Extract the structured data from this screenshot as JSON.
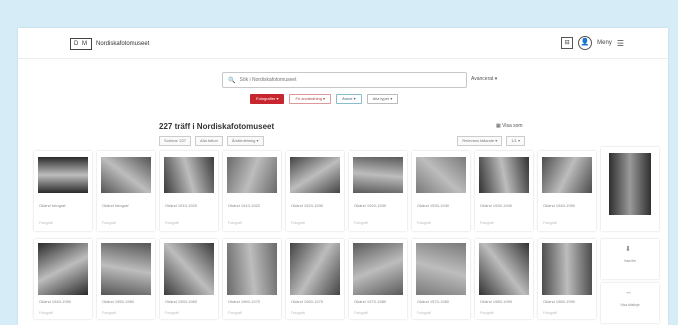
{
  "header": {
    "logo_box": "D M",
    "logo_text": "Nordiskafoto­museet",
    "icon_square": "⊟",
    "icon_avatar": "👤",
    "menu_label": "Meny",
    "hamburger": "☰"
  },
  "search": {
    "placeholder": "Sök i Nordiskafotomuseet",
    "advanced": "Avancerat ▾"
  },
  "filters": [
    "Fotografier ▾",
    "Fri användning ▾",
    "Ämne ▾",
    "Alla typer ▾"
  ],
  "results": {
    "title": "227 träff i Nordiskafotomuseet",
    "view_toggle": "▦ Visa som",
    "sort_left": [
      "Sortera: 227",
      "Alla fotton",
      "Årsfördelning ▾"
    ],
    "sort_right": [
      "Relevans fallande ▾",
      "1/1 ▾"
    ]
  },
  "cards": [
    {
      "l1": "Okänd fotograf",
      "l2": "Fotografi"
    },
    {
      "l1": "Okänd fotograf",
      "l2": "Fotografi"
    },
    {
      "l1": "Okänd 1910-1920",
      "l2": "Fotografi"
    },
    {
      "l1": "Okänd 1910-1920",
      "l2": "Fotografi"
    },
    {
      "l1": "Okänd 1920-1930",
      "l2": "Fotografi"
    },
    {
      "l1": "Okänd 1920-1930",
      "l2": "Fotografi"
    },
    {
      "l1": "Okänd 1930-1940",
      "l2": "Fotografi"
    },
    {
      "l1": "Okänd 1930-1940",
      "l2": "Fotografi"
    },
    {
      "l1": "Okänd 1940-1950",
      "l2": "Fotografi"
    },
    {
      "l1": "Okänd 1940-1950",
      "l2": "Fotografi"
    },
    {
      "l1": "Okänd 1950-1960",
      "l2": "Fotografi"
    },
    {
      "l1": "Okänd 1950-1960",
      "l2": "Fotografi"
    },
    {
      "l1": "Okänd 1960-1970",
      "l2": "Fotografi"
    },
    {
      "l1": "Okänd 1960-1970",
      "l2": "Fotografi"
    },
    {
      "l1": "Okänd 1970-1980",
      "l2": "Fotografi"
    },
    {
      "l1": "Okänd 1970-1980",
      "l2": "Fotografi"
    },
    {
      "l1": "Okänd 1980-1990",
      "l2": "Fotografi"
    },
    {
      "l1": "Okänd 1980-1990",
      "l2": "Fotografi"
    }
  ],
  "side_cards": [
    {
      "icon": "⬇",
      "label": "Visa fler"
    },
    {
      "icon": "↔",
      "label": "Visa tidslinje"
    }
  ],
  "colors": {
    "accent": "#c7262e",
    "background": "#d6ecf6"
  }
}
